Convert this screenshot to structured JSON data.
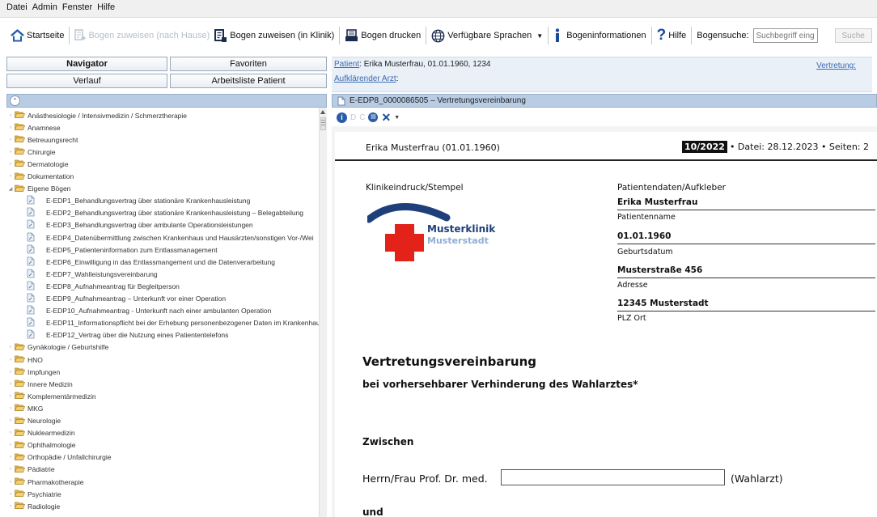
{
  "menu": [
    "Datei",
    "Admin",
    "Fenster",
    "Hilfe"
  ],
  "toolbar": {
    "home": "Startseite",
    "assign_home": "Bogen zuweisen (nach Hause)",
    "assign_clinic": "Bogen zuweisen (in Klinik)",
    "print": "Bogen drucken",
    "languages": "Verfügbare Sprachen",
    "info": "Bogeninformationen",
    "help": "Hilfe",
    "search_label": "Bogensuche:",
    "search_placeholder": "Suchbegriff eing",
    "search_button": "Suche"
  },
  "nav": {
    "navigator": "Navigator",
    "favorites": "Favoriten",
    "history": "Verlauf",
    "worklist": "Arbeitsliste Patient"
  },
  "tree": {
    "categories_top": [
      "Anästhesiologie / Intensivmedizin / Schmerztherapie",
      "Anamnese",
      "Betreuungsrecht",
      "Chirurgie",
      "Dermatologie",
      "Dokumentation"
    ],
    "open_category": "Eigene Bögen",
    "documents": [
      "E-EDP1_Behandlungsvertrag über stationäre Krankenhausleistung",
      "E-EDP2_Behandlungsvertrag über stationäre Krankenhausleistung – Belegabteilung",
      "E-EDP3_Behandlungsvertrag über ambulante Operationsleistungen",
      "E-EDP4_Datenübermittlung zwischen Krankenhaus und Hausärzten/sonstigen Vor-/Wei",
      "E-EDP5_Patienteninformation zum Entlassmanagement",
      "E-EDP6_Einwilligung in das Entlassmangement und die Datenverarbeitung",
      "E-EDP7_Wahlleistungsvereinbarung",
      "E-EDP8_Aufnahmeantrag für Begleitperson",
      "E-EDP9_Aufnahmeantrag – Unterkunft vor einer Operation",
      "E-EDP10_Aufnahmeantrag - Unterkunft nach einer ambulanten Operation",
      "E-EDP11_Informationspflicht bei der Erhebung personenbezogener Daten im Krankenhau",
      "E-EDP12_Vertrag über die Nutzung eines Patiententelefons"
    ],
    "categories_bottom": [
      "Gynäkologie / Geburtshilfe",
      "HNO",
      "Impfungen",
      "Innere Medizin",
      "Komplementärmedizin",
      "MKG",
      "Neurologie",
      "Nuklearmedizin",
      "Ophthalmologie",
      "Orthopädie / Unfallchirurgie",
      "Pädiatrie",
      "Pharmakotherapie",
      "Psychiatrie",
      "Radiologie"
    ]
  },
  "patient": {
    "label": "Patient",
    "value": ": Erika Musterfrau, 01.01.1960, 1234",
    "doctor_label": "Aufklärender Arzt",
    "doctor_value": ":",
    "substitute": "Vertretung:"
  },
  "document": {
    "tab_title": "E-EDP8_0000086505 – Vertretungsvereinbarung",
    "tool_d": "D",
    "tool_c": "C",
    "patient_name": "Erika  Musterfrau (01.01.1960)",
    "version": "10/2022",
    "meta": "• Datei: 28.12.2023 • Seiten: 2",
    "stamp_label": "Klinikeindruck/Stempel",
    "logo_name": "Musterklinik",
    "logo_city": "Musterstadt",
    "pd_title": "Patientendaten/Aufkleber",
    "pd_name": "Erika Musterfrau",
    "pd_name_label": "Patientenname",
    "pd_dob": "01.01.1960",
    "pd_dob_label": "Geburtsdatum",
    "pd_address": "Musterstraße 456",
    "pd_address_label": "Adresse",
    "pd_city": "12345 Musterstadt",
    "pd_city_label": "PLZ Ort",
    "heading": "Vertretungsvereinbarung",
    "subheading": "bei vorhersehbarer Verhinderung des Wahlarztes*",
    "between": "Zwischen",
    "herr_frau": "Herrn/Frau Prof. Dr. med.",
    "wahlarzt": "(Wahlarzt)",
    "and": "und"
  },
  "colors": {
    "panel_header": "#b8cce4",
    "info_bar": "#e9f0f8",
    "link": "#3e6ab0",
    "folder": "#e4b64a",
    "logo_blue": "#1e3f7a",
    "logo_red": "#e32219"
  }
}
